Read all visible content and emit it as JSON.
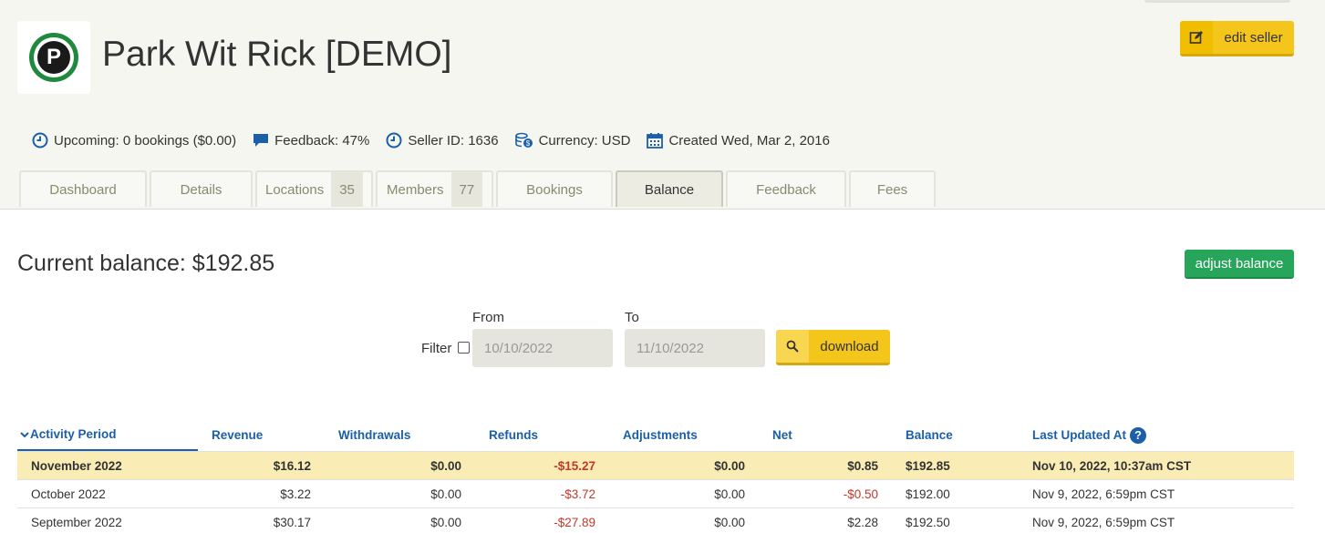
{
  "seller": {
    "name": "Park Wit Rick [DEMO]",
    "logo_letter": "P",
    "edit_label": "edit seller"
  },
  "meta": {
    "upcoming": "Upcoming: 0 bookings ($0.00)",
    "feedback": "Feedback: 47%",
    "seller_id": "Seller ID: 1636",
    "currency": "Currency: USD",
    "created": "Created Wed, Mar 2, 2016"
  },
  "tabs": [
    {
      "label": "Dashboard"
    },
    {
      "label": "Details"
    },
    {
      "label": "Locations",
      "count": "35"
    },
    {
      "label": "Members",
      "count": "77"
    },
    {
      "label": "Bookings"
    },
    {
      "label": "Balance",
      "active": true
    },
    {
      "label": "Feedback"
    },
    {
      "label": "Fees"
    }
  ],
  "balance": {
    "title": "Current balance: $192.85",
    "adjust_label": "adjust balance"
  },
  "filter": {
    "label": "Filter",
    "checked": false,
    "from_label": "From",
    "to_label": "To",
    "from_value": "10/10/2022",
    "to_value": "11/10/2022",
    "download_label": "download"
  },
  "table": {
    "columns": [
      "Activity Period",
      "Revenue",
      "Withdrawals",
      "Refunds",
      "Adjustments",
      "Net",
      "Balance",
      "Last Updated At"
    ],
    "sort_indicator": "⌄",
    "rows": [
      {
        "period": "November 2022",
        "revenue": "$16.12",
        "withdrawals": "$0.00",
        "refunds": "-$15.27",
        "adjustments": "$0.00",
        "net": "$0.85",
        "balance": "$192.85",
        "updated": "Nov 10, 2022, 10:37am CST",
        "highlight": true
      },
      {
        "period": "October 2022",
        "revenue": "$3.22",
        "withdrawals": "$0.00",
        "refunds": "-$3.72",
        "adjustments": "$0.00",
        "net": "-$0.50",
        "balance": "$192.00",
        "updated": "Nov 9, 2022, 6:59pm CST"
      },
      {
        "period": "September 2022",
        "revenue": "$30.17",
        "withdrawals": "$0.00",
        "refunds": "-$27.89",
        "adjustments": "$0.00",
        "net": "$2.28",
        "balance": "$192.50",
        "updated": "Nov 9, 2022, 6:59pm CST"
      }
    ]
  },
  "colors": {
    "accent_blue": "#1a5fa8",
    "button_yellow": "#f4c51b",
    "button_green": "#27a55a",
    "highlight_row": "#f9ecb4",
    "negative": "#c0392b"
  }
}
